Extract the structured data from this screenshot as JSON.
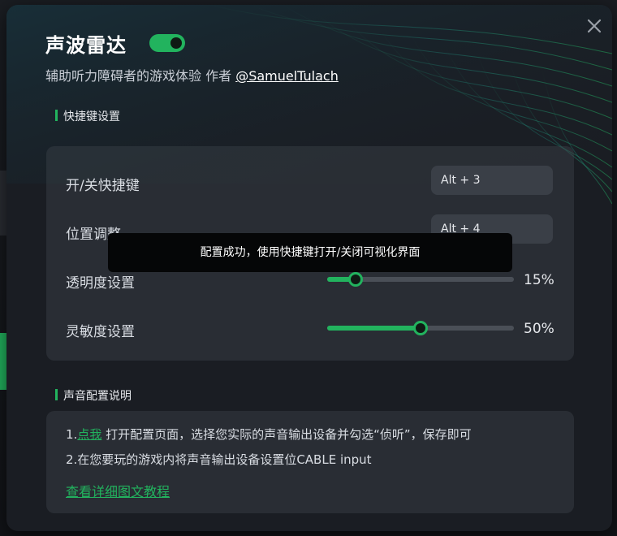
{
  "colors": {
    "accent": "#22b35e",
    "panel_bg": "#1a1d23",
    "text": "#d9dde3"
  },
  "header": {
    "title": "声波雷达",
    "toggle_on": true,
    "subtitle_prefix": "辅助听力障碍者的游戏体验 作者 ",
    "author": "@SamuelTulach"
  },
  "icons": {
    "close": "close-icon"
  },
  "shortcuts": {
    "section_title": "快捷键设置",
    "toggle_label": "开/关快捷键",
    "toggle_key": "Alt + 3",
    "position_label": "位置调整",
    "position_key": "Alt + 4",
    "opacity_label": "透明度设置",
    "opacity_value": 15,
    "opacity_text": "15%",
    "sensitivity_label": "灵敏度设置",
    "sensitivity_value": 50,
    "sensitivity_text": "50%"
  },
  "toast": {
    "message": "配置成功，使用快捷键打开/关闭可视化界面"
  },
  "sound": {
    "section_title": "声音配置说明",
    "line1_prefix": "1.",
    "line1_link": "点我",
    "line1_rest": " 打开配置页面，选择您实际的声音输出设备并勾选“侦听”，保存即可",
    "line2": "2.在您要玩的游戏内将声音输出设备设置位CABLE input",
    "tutorial_link": "查看详细图文教程"
  }
}
